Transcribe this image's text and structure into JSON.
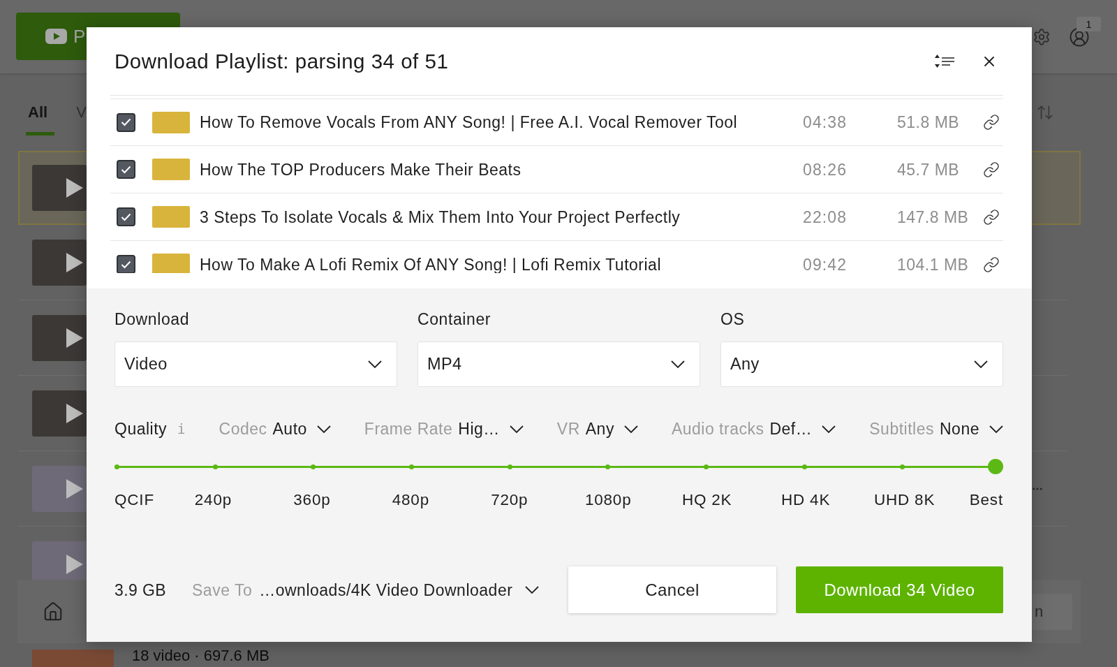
{
  "background": {
    "top_bar": {
      "primary_button": "P",
      "notification_count": "1"
    },
    "tabs": [
      {
        "label": "All",
        "selected": true
      },
      {
        "label": "V",
        "selected": false
      }
    ],
    "cards": [
      {
        "kind": "photo",
        "selected": true,
        "hovered": false
      },
      {
        "kind": "photo",
        "selected": false,
        "hovered": false
      },
      {
        "kind": "photo",
        "selected": false,
        "hovered": false
      },
      {
        "kind": "photo",
        "selected": false,
        "hovered": false
      },
      {
        "kind": "logo",
        "selected": false,
        "hovered": true
      },
      {
        "kind": "logo",
        "selected": false,
        "hovered": false
      }
    ],
    "bottom_bar": {
      "button": "n"
    },
    "partial_row": {
      "meta": "18 video · 697.6 MB"
    }
  },
  "dialog": {
    "title": "Download Playlist: parsing 34 of 51",
    "videos": [
      {
        "checked": true,
        "title": "How To Remove Vocals From ANY Song! | Free A.I. Vocal Remover Tool",
        "duration": "04:38",
        "size": "51.8 MB"
      },
      {
        "checked": true,
        "title": "How The TOP Producers Make Their Beats",
        "duration": "08:26",
        "size": "45.7 MB"
      },
      {
        "checked": true,
        "title": "3 Steps To Isolate Vocals & Mix Them Into Your Project Perfectly",
        "duration": "22:08",
        "size": "147.8 MB"
      },
      {
        "checked": true,
        "title": "How To Make A Lofi Remix Of ANY Song! | Lofi Remix Tutorial",
        "duration": "09:42",
        "size": "104.1 MB"
      }
    ],
    "fields": [
      {
        "label": "Download",
        "value": "Video"
      },
      {
        "label": "Container",
        "value": "MP4"
      },
      {
        "label": "OS",
        "value": "Any"
      }
    ],
    "options": [
      {
        "kind": "info",
        "label": "Quality",
        "value": "i"
      },
      {
        "kind": "dropdown",
        "label": "Codec",
        "value": "Auto"
      },
      {
        "kind": "dropdown",
        "label": "Frame Rate",
        "value": "Hig…"
      },
      {
        "kind": "dropdown",
        "label": "VR",
        "value": "Any"
      },
      {
        "kind": "dropdown",
        "label": "Audio tracks",
        "value": "Def…"
      },
      {
        "kind": "dropdown",
        "label": "Subtitles",
        "value": "None"
      }
    ],
    "quality": {
      "level": 1,
      "stops": [
        "QCIF",
        "240p",
        "360p",
        "480p",
        "720p",
        "1080p",
        "HQ 2K",
        "HD 4K",
        "UHD 8K",
        "Best"
      ]
    },
    "footer": {
      "total_size": "3.9 GB",
      "save_to": {
        "label": "Save To",
        "path": "…ownloads/4K Video Downloader"
      },
      "buttons": [
        {
          "kind": "secondary",
          "label": "Cancel"
        },
        {
          "kind": "primary",
          "label": "Download 34 Video"
        }
      ]
    }
  }
}
